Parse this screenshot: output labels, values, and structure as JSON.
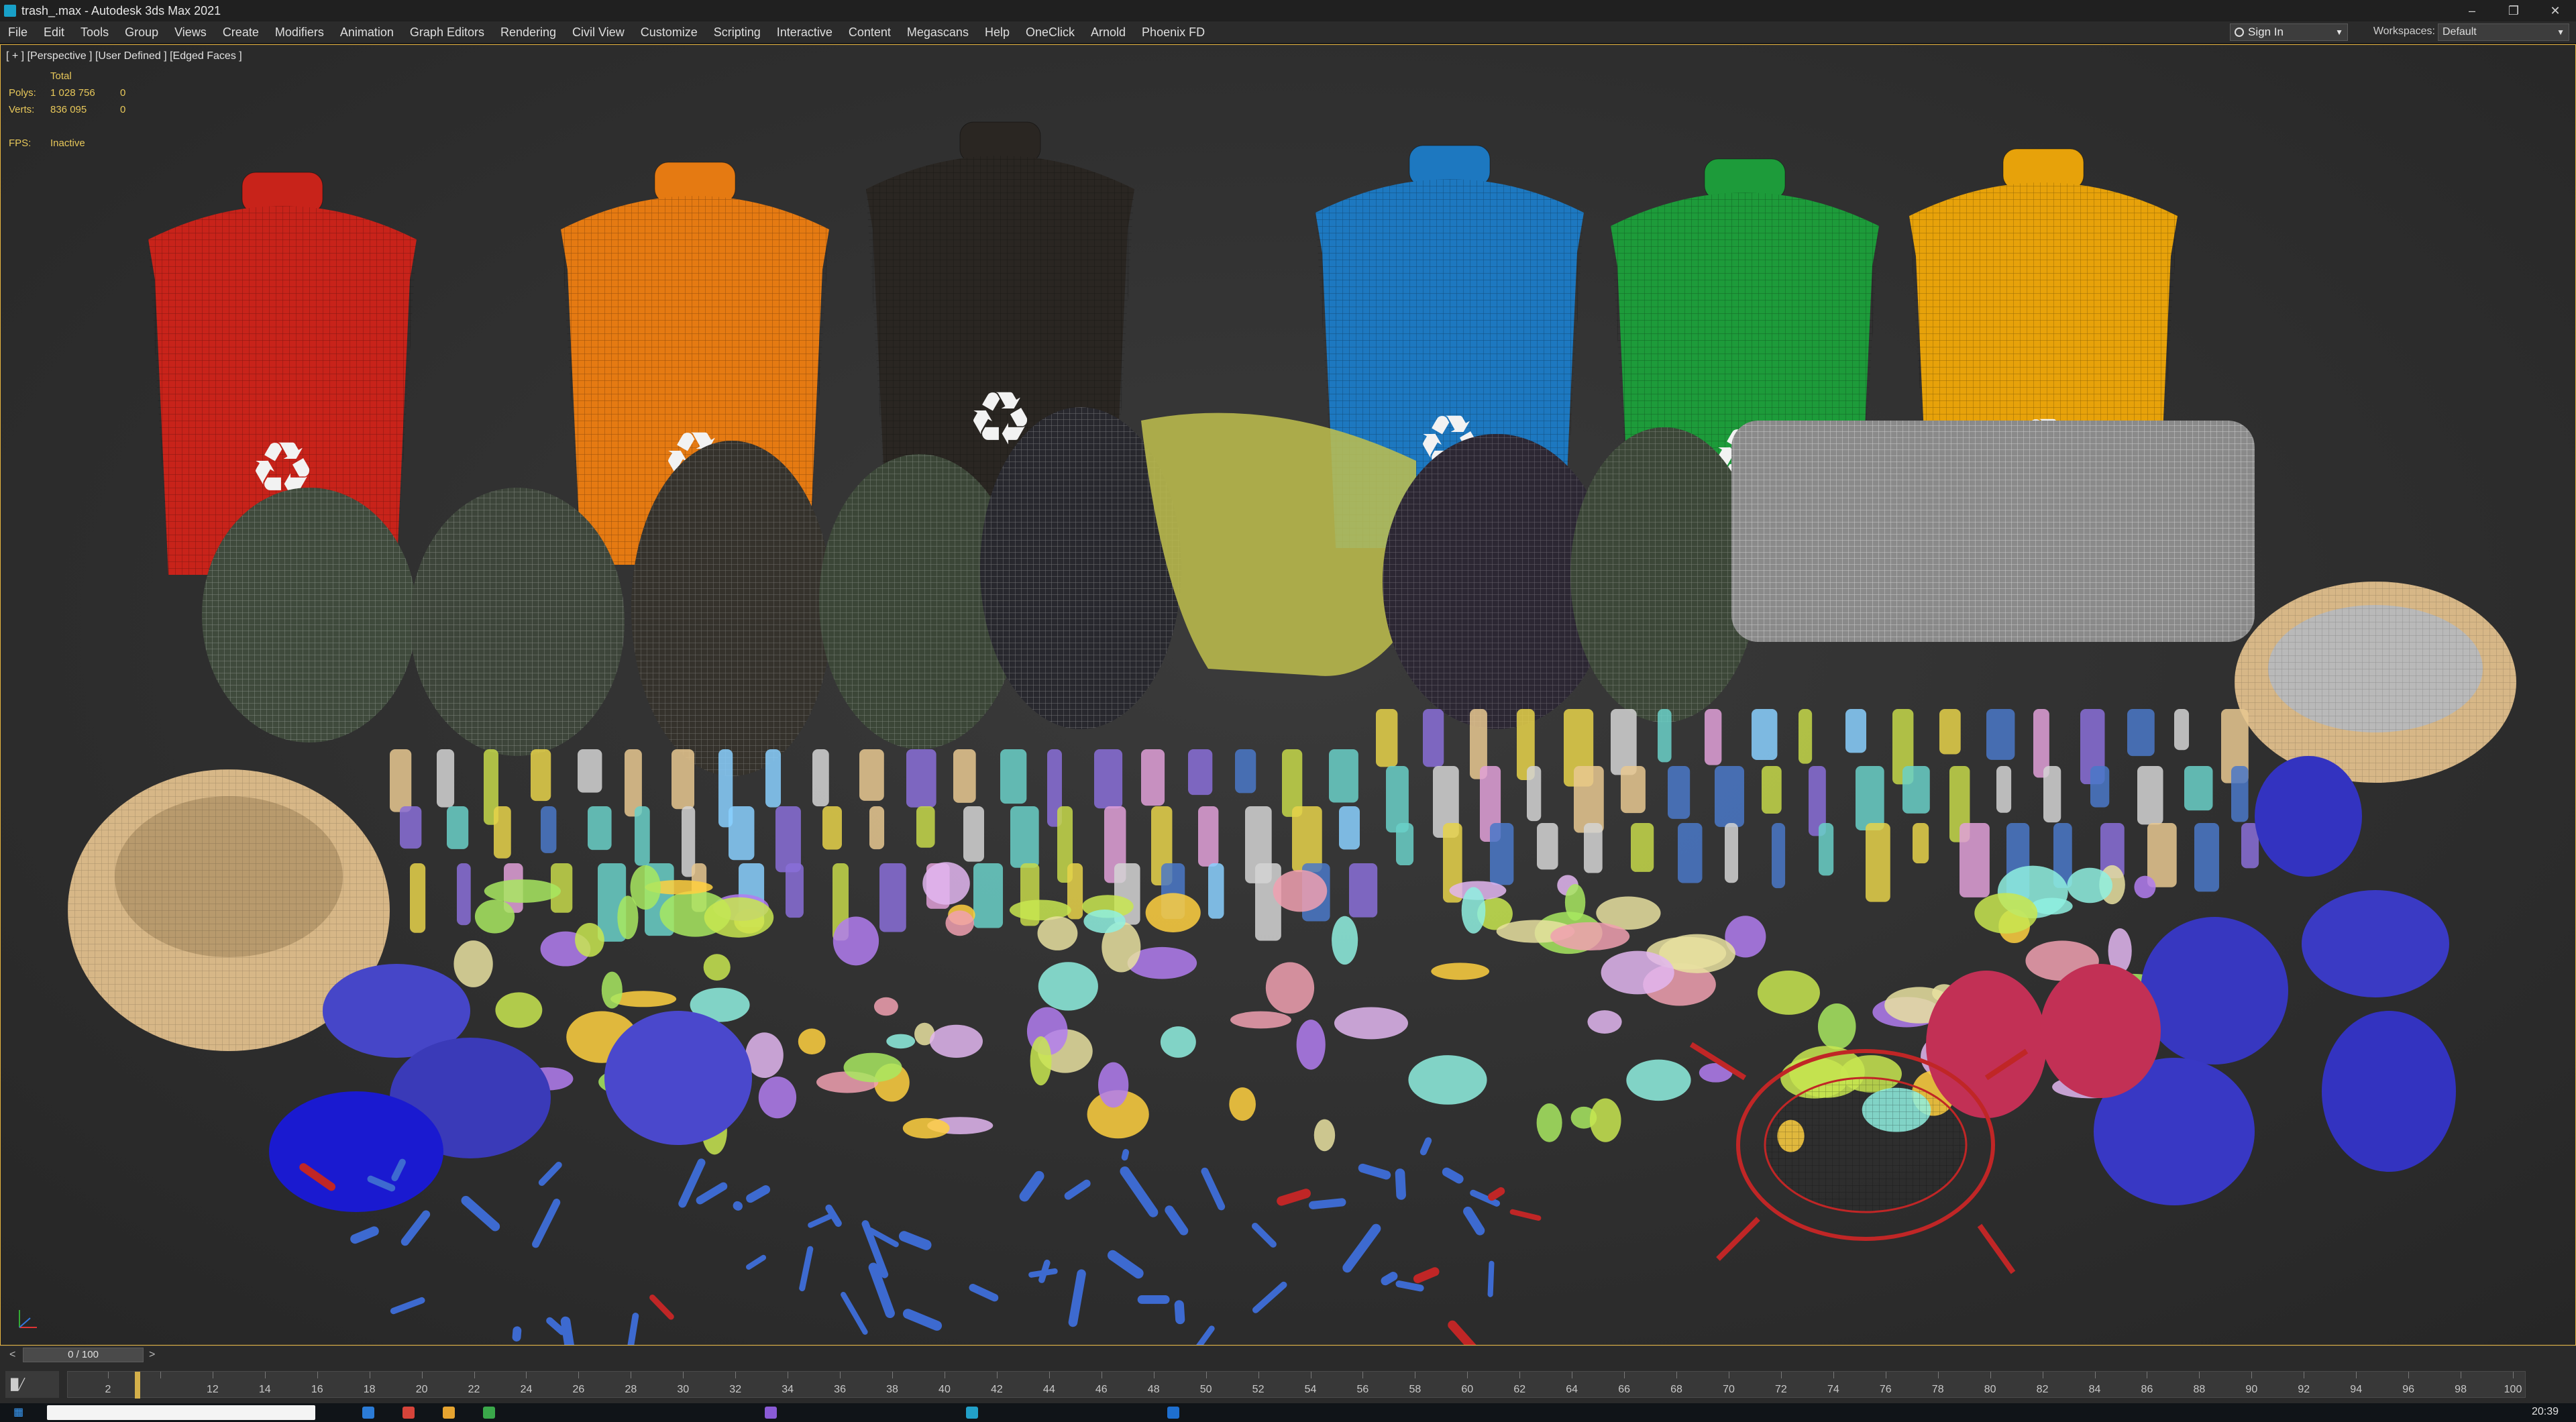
{
  "window": {
    "title": "trash_.max - Autodesk 3ds Max 2021"
  },
  "menu": {
    "items": [
      "File",
      "Edit",
      "Tools",
      "Group",
      "Views",
      "Create",
      "Modifiers",
      "Animation",
      "Graph Editors",
      "Rendering",
      "Civil View",
      "Customize",
      "Scripting",
      "Interactive",
      "Content",
      "Megascans",
      "Help",
      "OneClick",
      "Arnold",
      "Phoenix FD"
    ]
  },
  "account": {
    "signin_label": "Sign In"
  },
  "workspaces": {
    "label": "Workspaces:",
    "value": "Default"
  },
  "viewport": {
    "label": "[ + ] [Perspective ] [User Defined ] [Edged Faces ]",
    "stats": {
      "header": "Total",
      "polys_label": "Polys:",
      "polys_total": "1 028 756",
      "polys_sel": "0",
      "verts_label": "Verts:",
      "verts_total": "836 095",
      "verts_sel": "0",
      "fps_label": "FPS:",
      "fps_value": "Inactive"
    }
  },
  "timeline": {
    "position": "0 / 100",
    "ticks": [
      "2",
      "",
      "12",
      "14",
      "16",
      "18",
      "20",
      "22",
      "24",
      "26",
      "28",
      "30",
      "32",
      "34",
      "36",
      "38",
      "40",
      "42",
      "44",
      "46",
      "48",
      "50",
      "52",
      "54",
      "56",
      "58",
      "60",
      "62",
      "64",
      "66",
      "68",
      "70",
      "72",
      "74",
      "76",
      "78",
      "80",
      "82",
      "84",
      "86",
      "88",
      "90",
      "92",
      "94",
      "96",
      "98",
      "100"
    ]
  },
  "taskbar": {
    "clock": "20:39"
  },
  "colors": {
    "bins": [
      "#c8231a",
      "#e57a12",
      "#2a2622",
      "#1d78c0",
      "#1d9b3a",
      "#e7a20a"
    ],
    "accent": "#e7b540"
  }
}
